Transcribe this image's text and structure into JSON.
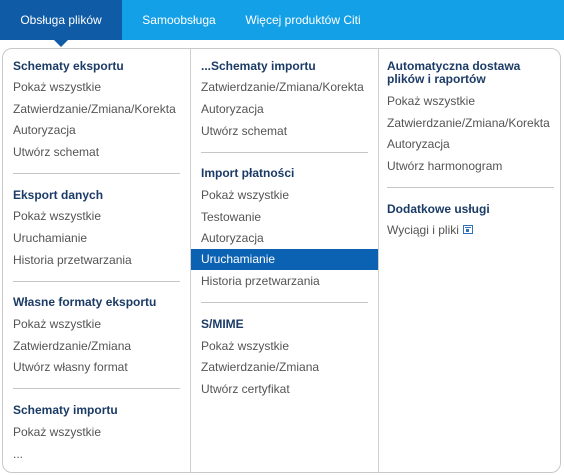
{
  "nav": {
    "tabs": [
      {
        "label": "Obsługa plików",
        "active": true
      },
      {
        "label": "Samoobsługa",
        "active": false
      },
      {
        "label": "Więcej produktów Citi",
        "active": false
      }
    ]
  },
  "menu": {
    "col1": {
      "s1": {
        "title": "Schematy eksportu",
        "items": [
          "Pokaż wszystkie",
          "Zatwierdzanie/Zmiana/Korekta",
          "Autoryzacja",
          "Utwórz schemat"
        ]
      },
      "s2": {
        "title": "Eksport danych",
        "items": [
          "Pokaż wszystkie",
          "Uruchamianie",
          "Historia przetwarzania"
        ]
      },
      "s3": {
        "title": "Własne formaty eksportu",
        "items": [
          "Pokaż wszystkie",
          "Zatwierdzanie/Zmiana",
          "Utwórz własny format"
        ]
      },
      "s4": {
        "title": "Schematy importu",
        "items": [
          "Pokaż wszystkie",
          "..."
        ]
      }
    },
    "col2": {
      "s1": {
        "title": "...Schematy importu",
        "items": [
          "Zatwierdzanie/Zmiana/Korekta",
          "Autoryzacja",
          "Utwórz schemat"
        ]
      },
      "s2": {
        "title": "Import płatności",
        "items": [
          "Pokaż wszystkie",
          "Testowanie",
          "Autoryzacja",
          "Uruchamianie",
          "Historia przetwarzania"
        ],
        "highlighted_item": "Uruchamianie"
      },
      "s3": {
        "title": "S/MIME",
        "items": [
          "Pokaż wszystkie",
          "Zatwierdzanie/Zmiana",
          "Utwórz certyfikat"
        ]
      }
    },
    "col3": {
      "s1": {
        "title": "Automatyczna dostawa plików i raportów",
        "items": [
          "Pokaż wszystkie",
          "Zatwierdzanie/Zmiana/Korekta",
          "Autoryzacja",
          "Utwórz harmonogram"
        ]
      },
      "s2": {
        "title": "Dodatkowe usługi",
        "items": [
          "Wyciągi i pliki"
        ],
        "item_icon": "external-window-icon"
      }
    }
  },
  "colors": {
    "topbar": "#14a0e6",
    "active_tab": "#0f5ba6",
    "section_title": "#1b3b66",
    "link": "#545454",
    "highlight": "#0b62b2"
  }
}
